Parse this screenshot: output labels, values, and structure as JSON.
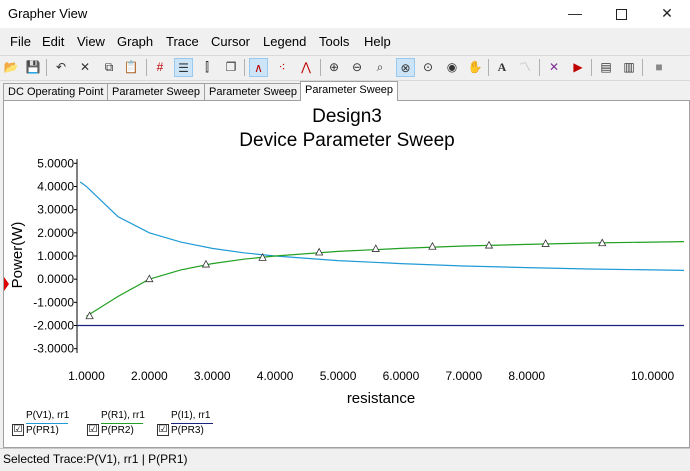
{
  "window": {
    "title": "Grapher View"
  },
  "menu": [
    "File",
    "Edit",
    "View",
    "Graph",
    "Trace",
    "Cursor",
    "Legend",
    "Tools",
    "Help"
  ],
  "toolbar": {
    "icons": [
      "open-folder-icon",
      "save-icon",
      "undo-icon",
      "delete-icon",
      "copy-icon",
      "paste-icon",
      "grid-icon",
      "legend-icon",
      "cursors-icon",
      "stack-icon",
      "plot-line-icon",
      "plot-points-icon",
      "plot-line-points-icon",
      "zoom-in-icon",
      "zoom-out-icon",
      "zoom-fit-icon",
      "zoom-x-icon",
      "zoom-y-icon",
      "pan-hand-icon",
      "text-icon",
      "analysis-icon",
      "merge-traces-icon",
      "export-icon",
      "print-icon",
      "copy-graph-icon",
      "stop-icon"
    ]
  },
  "tabs": [
    "DC Operating Point",
    "Parameter Sweep",
    "Parameter Sweep",
    "Parameter Sweep"
  ],
  "active_tab": 3,
  "chart_data": {
    "type": "line",
    "title": "Design3",
    "subtitle": "Device Parameter Sweep",
    "xlabel": "resistance",
    "ylabel": "Power(W)",
    "xlim": [
      0.85,
      10.5
    ],
    "ylim": [
      -3.1,
      5.1
    ],
    "xticks": [
      "1.0000",
      "2.0000",
      "3.0000",
      "4.0000",
      "5.0000",
      "6.0000",
      "7.0000",
      "8.0000",
      "10.0000"
    ],
    "yticks": [
      "5.0000",
      "4.0000",
      "3.0000",
      "2.0000",
      "1.0000",
      "0.0000",
      "-1.0000",
      "-2.0000",
      "-3.0000"
    ],
    "grid": false,
    "series": [
      {
        "name": "P(V1), rr1",
        "color": "#1f9ad6",
        "x": [
          0.9,
          1,
          1.5,
          2,
          2.5,
          3,
          3.5,
          4,
          5,
          6,
          7,
          8,
          9,
          10,
          10.5
        ],
        "y": [
          4.2,
          4.0,
          2.7,
          2.0,
          1.6,
          1.33,
          1.14,
          1.0,
          0.8,
          0.67,
          0.57,
          0.5,
          0.44,
          0.4,
          0.38
        ]
      },
      {
        "name": "P(R1), rr1",
        "color": "#22a022",
        "x": [
          1,
          1.5,
          2,
          2.5,
          3,
          3.5,
          4,
          5,
          6,
          7,
          8,
          9,
          10,
          10.5
        ],
        "y": [
          -1.6,
          -0.75,
          0.0,
          0.4,
          0.67,
          0.86,
          1.0,
          1.2,
          1.33,
          1.43,
          1.5,
          1.56,
          1.6,
          1.62
        ]
      },
      {
        "name": "P(I1), rr1",
        "color": "#1a237e",
        "x": [
          0.85,
          10.5
        ],
        "y": [
          -2.0,
          -2.0
        ]
      }
    ],
    "markers": {
      "series": "P(R1), rr1",
      "x": [
        1.05,
        2.0,
        2.9,
        3.8,
        4.7,
        5.6,
        6.5,
        7.4,
        8.3,
        9.2
      ],
      "y": [
        -1.6,
        0.0,
        0.63,
        0.92,
        1.15,
        1.3,
        1.4,
        1.45,
        1.52,
        1.55
      ]
    }
  },
  "legend": [
    {
      "top": "P(V1), rr1",
      "bottom": "P(PR1)",
      "checked": "☑",
      "color": "#1f9ad6"
    },
    {
      "top": "P(R1), rr1",
      "bottom": "P(PR2)",
      "checked": "☑",
      "color": "#22a022"
    },
    {
      "top": "P(I1), rr1",
      "bottom": "P(PR3)",
      "checked": "☑",
      "color": "#1a237e"
    }
  ],
  "status": {
    "selected_trace": "Selected Trace:P(V1), rr1 | P(PR1)"
  }
}
